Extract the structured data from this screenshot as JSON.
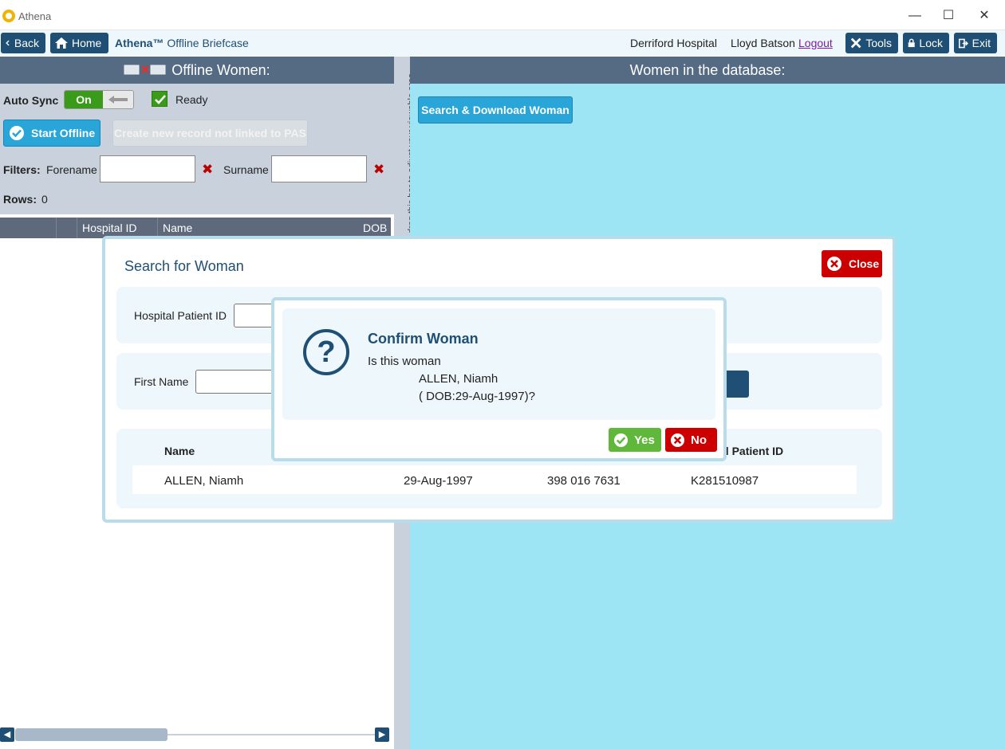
{
  "window": {
    "title": "Athena",
    "minimize": "—",
    "maximize": "☐",
    "close": "✕"
  },
  "toolbar": {
    "back_label": "Back",
    "home_label": "Home",
    "app_name_bold": "Athena™",
    "app_name_rest": " Offline Briefcase",
    "hospital": "Derriford Hospital",
    "user": "Lloyd Batson",
    "logout_label": "Logout",
    "tools_label": "Tools",
    "lock_label": "Lock",
    "exit_label": "Exit"
  },
  "left": {
    "header": "Offline Women:",
    "auto_sync_label": "Auto Sync",
    "toggle_state": "On",
    "ready_label": "Ready",
    "start_offline_label": "Start Offline",
    "create_record_label": "Create new record not linked to PAS",
    "filters_label": "Filters:",
    "forename_label": "Forename",
    "surname_label": "Surname",
    "forename_value": "",
    "surname_value": "",
    "rows_label": "Rows:",
    "rows_count": "0",
    "columns": [
      "Hospital ID",
      "Name",
      "DOB"
    ]
  },
  "splitter": {
    "hint": "drag this bar to adjust your viewable area"
  },
  "right": {
    "header": "Women in the database:",
    "search_download_label": "Search & Download Woman"
  },
  "search_dialog": {
    "title": "Search for Woman",
    "close_label": "Close",
    "hospital_patient_id_label": "Hospital Patient ID",
    "first_name_label": "First Name",
    "results_header_name": "Name",
    "results_header_patient_id": "al Patient ID",
    "result": {
      "name": "ALLEN, Niamh",
      "dob": "29-Aug-1997",
      "nhs_number": "398 016 7631",
      "patient_id": "K281510987"
    }
  },
  "confirm_dialog": {
    "title": "Confirm Woman",
    "question": "Is this woman",
    "name": "ALLEN, Niamh",
    "dob_line": "( DOB:29-Aug-1997)?",
    "yes_label": "Yes",
    "no_label": "No"
  },
  "colors": {
    "navy": "#1f4f75",
    "header_bg": "#556b84",
    "right_bg": "#9de4f5",
    "accent_blue": "#2aa5d8",
    "danger": "#cc0000",
    "success": "#5fb83a"
  }
}
